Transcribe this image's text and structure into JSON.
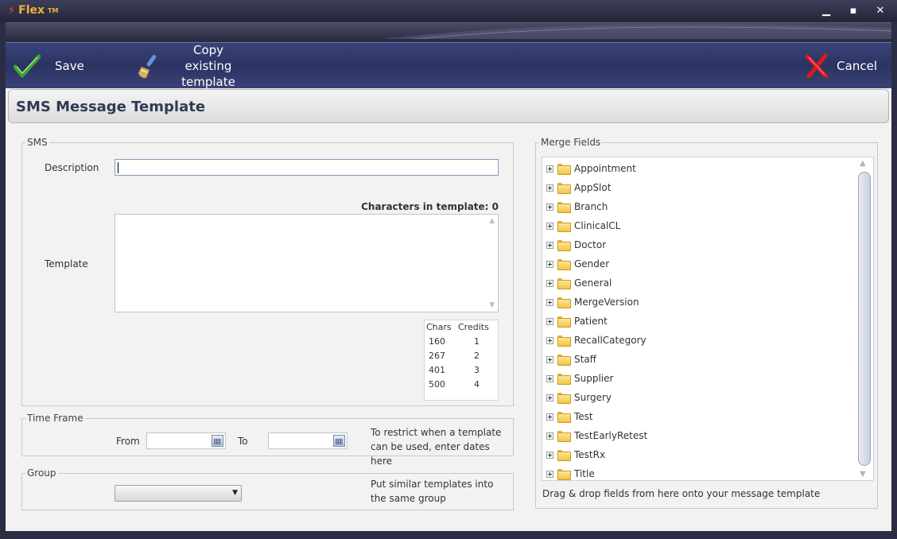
{
  "app": {
    "title": "Flex",
    "trademark": "TM"
  },
  "toolbar": {
    "save_label": "Save",
    "copy_label": "Copy existing template",
    "cancel_label": "Cancel"
  },
  "page": {
    "title": "SMS Message Template"
  },
  "sms": {
    "legend": "SMS",
    "description_label": "Description",
    "description_value": "",
    "template_label": "Template",
    "template_value": "",
    "chars_in_template": "Characters in template: 0",
    "credits_table": {
      "headers": [
        "Chars",
        "Credits"
      ],
      "rows": [
        [
          "160",
          "1"
        ],
        [
          "267",
          "2"
        ],
        [
          "401",
          "3"
        ],
        [
          "500",
          "4"
        ]
      ]
    }
  },
  "time_frame": {
    "legend": "Time Frame",
    "from_label": "From",
    "to_label": "To",
    "from_value": "",
    "to_value": "",
    "hint": "To restrict when a template can be used, enter dates here"
  },
  "group": {
    "legend": "Group",
    "selected": "",
    "hint": "Put similar templates into the same group"
  },
  "merge_fields": {
    "legend": "Merge Fields",
    "items": [
      "Appointment",
      "AppSlot",
      "Branch",
      "ClinicalCL",
      "Doctor",
      "Gender",
      "General",
      "MergeVersion",
      "Patient",
      "RecallCategory",
      "Staff",
      "Supplier",
      "Surgery",
      "Test",
      "TestEarlyRetest",
      "TestRx",
      "Title"
    ],
    "hint": "Drag & drop fields from here onto your message template"
  },
  "icons": {
    "save": "checkmark-icon",
    "copy": "brush-icon",
    "cancel": "red-x-icon",
    "calendar": "calendar-icon",
    "folder": "folder-icon",
    "expand": "plus-expander-icon"
  },
  "colors": {
    "title_accent": "#f2b136",
    "toolbar_bg": "#2c3363",
    "save_green": "#3aa530",
    "cancel_red": "#d81c1c"
  }
}
